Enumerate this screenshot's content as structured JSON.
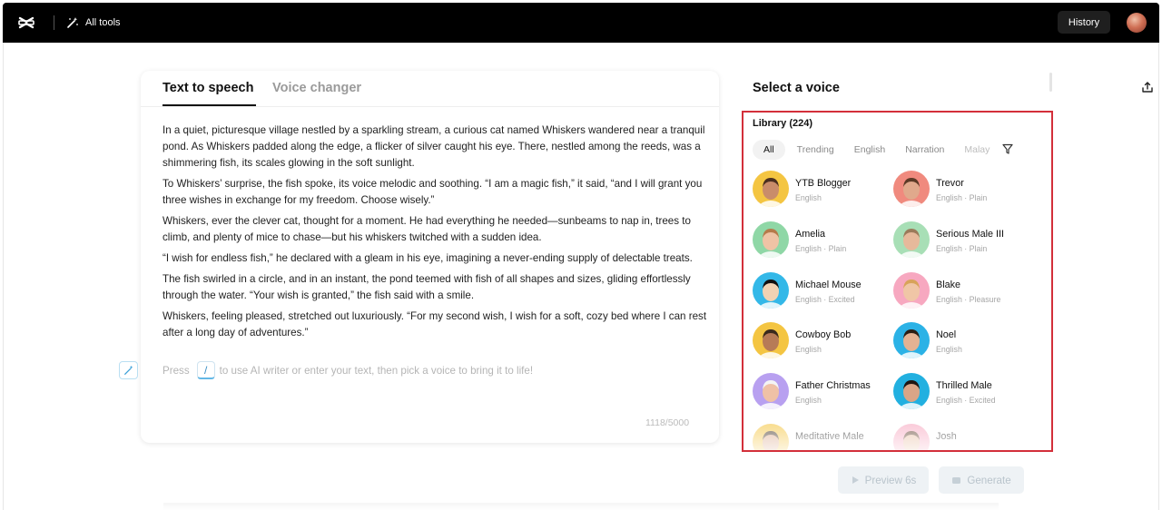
{
  "topbar": {
    "logo_icon": "capcut-logo-icon",
    "all_tools_label": "All tools",
    "history_label": "History"
  },
  "editor": {
    "tabs": [
      {
        "label": "Text to speech",
        "active": true
      },
      {
        "label": "Voice changer",
        "active": false
      }
    ],
    "paragraphs": [
      "In a quiet, picturesque village nestled by a sparkling stream, a curious cat named Whiskers wandered near a tranquil pond. As Whiskers padded along the edge, a flicker of silver caught his eye. There, nestled among the reeds, was a shimmering fish, its scales glowing in the soft sunlight.",
      "To Whiskers’ surprise, the fish spoke, its voice melodic and soothing. “I am a magic fish,” it said, “and I will grant you three wishes in exchange for my freedom. Choose wisely.”",
      "Whiskers, ever the clever cat, thought for a moment. He had everything he needed—sunbeams to nap in, trees to climb, and plenty of mice to chase—but his whiskers twitched with a sudden idea.",
      "“I wish for endless fish,” he declared with a gleam in his eye, imagining a never-ending supply of delectable treats.",
      "The fish swirled in a circle, and in an instant, the pond teemed with fish of all shapes and sizes, gliding effortlessly through the water. “Your wish is granted,” the fish said with a smile.",
      "Whiskers, feeling pleased, stretched out luxuriously. “For my second wish, I wish for a soft, cozy bed where I can rest after a long day of adventures.”"
    ],
    "hint_before": "Press",
    "hint_key": "/",
    "hint_after": "to use AI writer or enter your text, then pick a voice to bring it to life!",
    "counter": "1118/5000"
  },
  "voice_panel": {
    "title": "Select a voice",
    "library_label": "Library (224)",
    "filters": [
      "All",
      "Trending",
      "English",
      "Narration",
      "Malay"
    ],
    "active_filter": "All",
    "voices": [
      {
        "name": "YTB Blogger",
        "tags": "English",
        "bg": "#f4c542",
        "skin": "#c98c6a",
        "hair": "#4a2f20"
      },
      {
        "name": "Trevor",
        "tags": "English · Plain",
        "bg": "#f08a7e",
        "skin": "#e0a98c",
        "hair": "#5b3a26"
      },
      {
        "name": "Amelia",
        "tags": "English · Plain",
        "bg": "#8fd7a6",
        "skin": "#efc3a5",
        "hair": "#b57a4a"
      },
      {
        "name": "Serious Male III",
        "tags": "English · Plain",
        "bg": "#a8dfb6",
        "skin": "#e6b99b",
        "hair": "#9a7a5a"
      },
      {
        "name": "Michael Mouse",
        "tags": "English · Excited",
        "bg": "#33b8e8",
        "skin": "#f1d2b3",
        "hair": "#111111"
      },
      {
        "name": "Blake",
        "tags": "English · Pleasure",
        "bg": "#f7a8c0",
        "skin": "#f0c6a6",
        "hair": "#d8a35a"
      },
      {
        "name": "Cowboy Bob",
        "tags": "English",
        "bg": "#f4c542",
        "skin": "#b77b57",
        "hair": "#3a2a1d"
      },
      {
        "name": "Noel",
        "tags": "English",
        "bg": "#2bb2e6",
        "skin": "#e3b293",
        "hair": "#2a1e15"
      },
      {
        "name": "Father Christmas",
        "tags": "English",
        "bg": "#b8a0f0",
        "skin": "#efc1a6",
        "hair": "#f4f4f4"
      },
      {
        "name": "Thrilled Male",
        "tags": "English · Excited",
        "bg": "#22b0e0",
        "skin": "#d9a587",
        "hair": "#1e1612"
      },
      {
        "name": "Meditative Male",
        "tags": "",
        "bg": "#f4c542",
        "skin": "#d9a587",
        "hair": "#3a2a1d"
      },
      {
        "name": "Josh",
        "tags": "",
        "bg": "#f7a8c0",
        "skin": "#e6b99b",
        "hair": "#5b3a26"
      }
    ]
  },
  "actions": {
    "preview_label": "Preview 6s",
    "generate_label": "Generate"
  }
}
